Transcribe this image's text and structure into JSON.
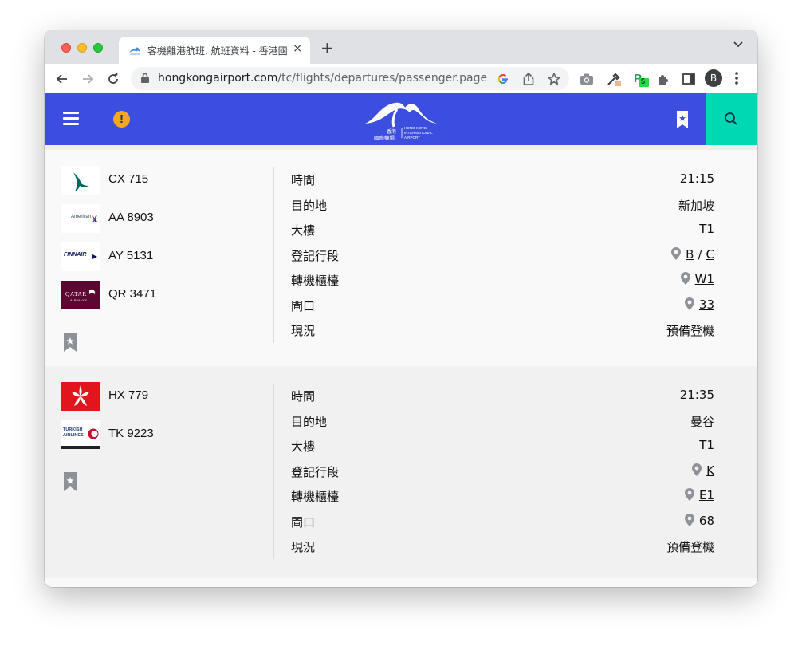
{
  "browser": {
    "tab_title": "客機離港航班, 航班資料 - 香港國際機場",
    "tab_close": "×",
    "new_tab": "+",
    "url_host": "hongkongairport.com",
    "url_path": "/tc/flights/departures/passenger.page",
    "profile_initial": "B",
    "ext_badge": "5"
  },
  "header": {
    "logo_alt": "香港國際機場 HONG KONG INTERNATIONAL AIRPORT",
    "logo_zh_1": "香港",
    "logo_zh_2": "國際機場",
    "logo_en_1": "HONG KONG",
    "logo_en_2": "INTERNATIONAL",
    "logo_en_3": "AIRPORT",
    "alert": "!",
    "colors": {
      "primary": "#3c4ee0",
      "search": "#00d8b3",
      "alert": "#f5a623"
    }
  },
  "labels": {
    "time": "時間",
    "destination": "目的地",
    "terminal": "大樓",
    "check_in": "登記行段",
    "transfer": "轉機櫃檯",
    "gate": "閘口",
    "status": "現況"
  },
  "flights": [
    {
      "airlines": [
        {
          "logo": "cathay-pacific-logo",
          "flight_no": "CX 715"
        },
        {
          "logo": "american-airlines-logo",
          "flight_no": "AA 8903",
          "logo_text": "American"
        },
        {
          "logo": "finnair-logo",
          "flight_no": "AY 5131",
          "logo_text": "FINNAIR"
        },
        {
          "logo": "qatar-airways-logo",
          "flight_no": "QR 3471",
          "logo_text": "QATAR",
          "logo_sub": "AIRWAYS"
        }
      ],
      "time": "21:15",
      "destination": "新加坡",
      "terminal": "T1",
      "check_in": [
        "B",
        "C"
      ],
      "check_in_sep": "/",
      "transfer": "W1",
      "gate": "33",
      "status": "預備登機"
    },
    {
      "airlines": [
        {
          "logo": "hong-kong-airlines-logo",
          "flight_no": "HX 779"
        },
        {
          "logo": "turkish-airlines-logo",
          "flight_no": "TK 9223",
          "logo_text": "TURKISH",
          "logo_sub": "AIRLINES"
        }
      ],
      "time": "21:35",
      "destination": "曼谷",
      "terminal": "T1",
      "check_in": [
        "K"
      ],
      "transfer": "E1",
      "gate": "68",
      "status": "預備登機"
    }
  ]
}
